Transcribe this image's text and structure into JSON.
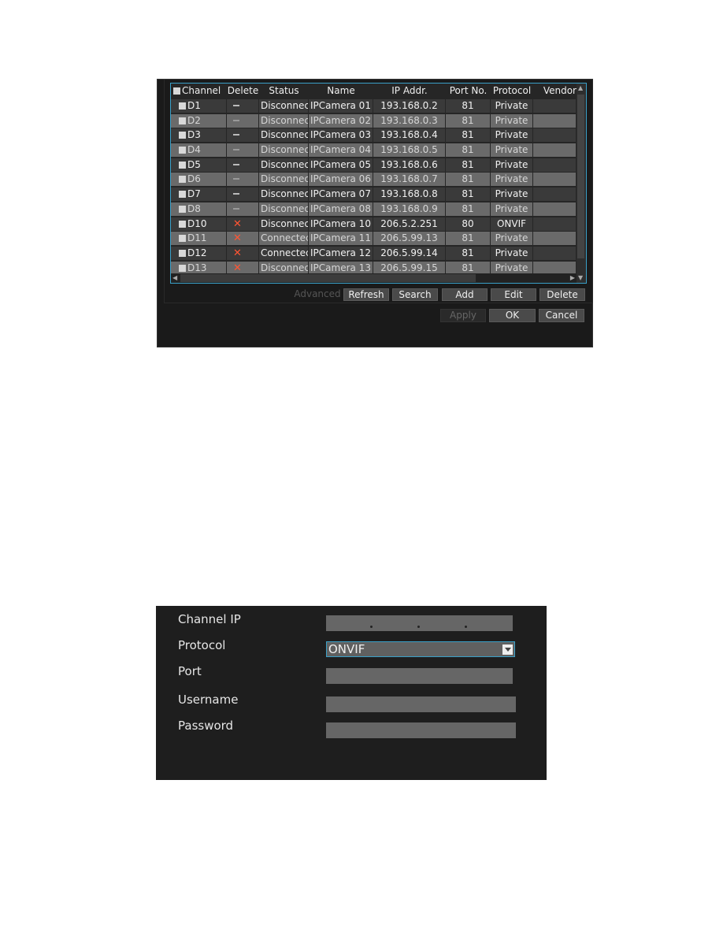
{
  "channel_table": {
    "columns": [
      "Channel",
      "Delete",
      "Status",
      "Name",
      "IP Addr.",
      "Port No.",
      "Protocol",
      "Vendor"
    ],
    "rows": [
      {
        "channel": "D1",
        "delete": "dash",
        "status": "Disconnec",
        "name": "IPCamera 01",
        "ip": "193.168.0.2",
        "port": "81",
        "protocol": "Private",
        "vendor": ""
      },
      {
        "channel": "D2",
        "delete": "dash",
        "status": "Disconnec",
        "name": "IPCamera 02",
        "ip": "193.168.0.3",
        "port": "81",
        "protocol": "Private",
        "vendor": ""
      },
      {
        "channel": "D3",
        "delete": "dash",
        "status": "Disconnec",
        "name": "IPCamera 03",
        "ip": "193.168.0.4",
        "port": "81",
        "protocol": "Private",
        "vendor": ""
      },
      {
        "channel": "D4",
        "delete": "dash",
        "status": "Disconnec",
        "name": "IPCamera 04",
        "ip": "193.168.0.5",
        "port": "81",
        "protocol": "Private",
        "vendor": ""
      },
      {
        "channel": "D5",
        "delete": "dash",
        "status": "Disconnec",
        "name": "IPCamera 05",
        "ip": "193.168.0.6",
        "port": "81",
        "protocol": "Private",
        "vendor": ""
      },
      {
        "channel": "D6",
        "delete": "dash",
        "status": "Disconnec",
        "name": "IPCamera 06",
        "ip": "193.168.0.7",
        "port": "81",
        "protocol": "Private",
        "vendor": ""
      },
      {
        "channel": "D7",
        "delete": "dash",
        "status": "Disconnec",
        "name": "IPCamera 07",
        "ip": "193.168.0.8",
        "port": "81",
        "protocol": "Private",
        "vendor": ""
      },
      {
        "channel": "D8",
        "delete": "dash",
        "status": "Disconnec",
        "name": "IPCamera 08",
        "ip": "193.168.0.9",
        "port": "81",
        "protocol": "Private",
        "vendor": ""
      },
      {
        "channel": "D10",
        "delete": "x",
        "status": "Disconnec",
        "name": "IPCamera 10",
        "ip": "206.5.2.251",
        "port": "80",
        "protocol": "ONVIF",
        "vendor": ""
      },
      {
        "channel": "D11",
        "delete": "x",
        "status": "Connectec",
        "name": "IPCamera 11",
        "ip": "206.5.99.13",
        "port": "81",
        "protocol": "Private",
        "vendor": ""
      },
      {
        "channel": "D12",
        "delete": "x",
        "status": "Connectec",
        "name": "IPCamera 12",
        "ip": "206.5.99.14",
        "port": "81",
        "protocol": "Private",
        "vendor": ""
      },
      {
        "channel": "D13",
        "delete": "x",
        "status": "Disconnec",
        "name": "IPCamera 13",
        "ip": "206.5.99.15",
        "port": "81",
        "protocol": "Private",
        "vendor": ""
      }
    ]
  },
  "actions": {
    "advanced": "Advanced",
    "refresh": "Refresh",
    "search": "Search",
    "add": "Add",
    "edit": "Edit",
    "delete": "Delete"
  },
  "dialog_buttons": {
    "apply": "Apply",
    "ok": "OK",
    "cancel": "Cancel"
  },
  "add_form": {
    "channel_ip_label": "Channel IP",
    "channel_ip_value": "",
    "protocol_label": "Protocol",
    "protocol_value": "ONVIF",
    "port_label": "Port",
    "port_value": "",
    "username_label": "Username",
    "username_value": "",
    "password_label": "Password",
    "password_value": ""
  },
  "colors": {
    "accent": "#3aa0c8",
    "delete_x": "#ff5533",
    "panel_bg": "#1a1a1a"
  }
}
